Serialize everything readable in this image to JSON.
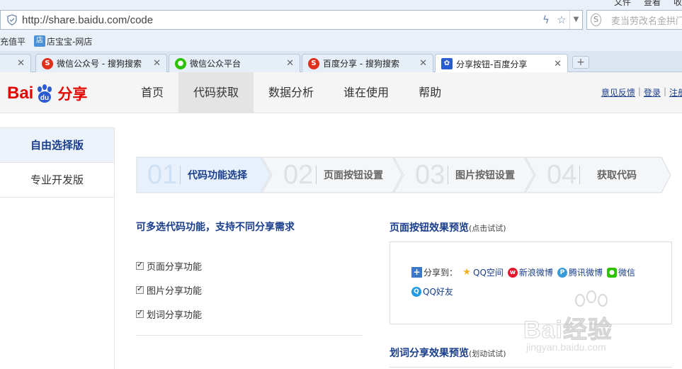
{
  "browser": {
    "menu": [
      "文件",
      "查看",
      "收"
    ],
    "url": "http://share.baidu.com/code",
    "search_placeholder": "麦当劳改名金拱门",
    "bookmarks": [
      {
        "label": "充值平"
      },
      {
        "label": "店宝宝-网店"
      }
    ],
    "tabs": [
      {
        "label": ""
      },
      {
        "label": "微信公众号 - 搜狗搜索"
      },
      {
        "label": "微信公众平台"
      },
      {
        "label": "百度分享 - 搜狗搜索"
      },
      {
        "label": "分享按钮-百度分享"
      }
    ],
    "new_tab": "+"
  },
  "header": {
    "logo_text": "Bai",
    "logo_du": "du",
    "logo_suffix": "分享",
    "nav": [
      "首页",
      "代码获取",
      "数据分析",
      "谁在使用",
      "帮助"
    ],
    "active_nav": "代码获取",
    "links": [
      "意见反馈",
      "登录",
      "注册"
    ]
  },
  "sidebar": {
    "items": [
      "自由选择版",
      "专业开发版"
    ]
  },
  "steps": [
    {
      "num": "01",
      "label": "代码功能选择"
    },
    {
      "num": "02",
      "label": "页面按钮设置"
    },
    {
      "num": "03",
      "label": "图片按钮设置"
    },
    {
      "num": "04",
      "label": "获取代码"
    }
  ],
  "options": {
    "title": "可多选代码功能，支持不同分享需求",
    "items": [
      {
        "label": "页面分享功能",
        "checked": true
      },
      {
        "label": "图片分享功能",
        "checked": true
      },
      {
        "label": "划词分享功能",
        "checked": true
      }
    ]
  },
  "preview": {
    "page_title": "页面按钮效果预览",
    "page_hint": "(点击试试)",
    "share_lead": "分享到：",
    "share_items": [
      "QQ空间",
      "新浪微博",
      "腾讯微博",
      "微信",
      "QQ好友"
    ],
    "word_title": "划词分享效果预览",
    "word_hint": "(划动试试)"
  },
  "watermark": {
    "text": "Bai经验",
    "url": "jingyan.baidu.com"
  },
  "colors": {
    "brand_red": "#e10601",
    "link_blue": "#1a3e8c",
    "step_active_bg": "#e8f1fb"
  }
}
